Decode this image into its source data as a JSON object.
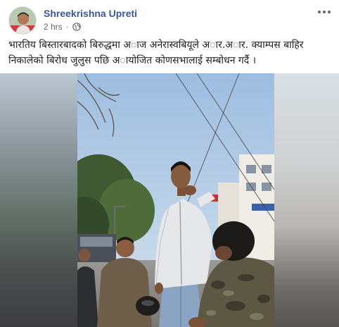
{
  "post": {
    "author_name": "Shreekrishna Upreti",
    "timestamp": "2 hrs",
    "separator": "·",
    "privacy_icon": "globe-icon",
    "menu_icon": "more-options-icon",
    "caption": "भारतिय बिस्तारबादको बिरुद्धमा अाज अनेरास्वबियूले अार.अार. क्याम्पस बाहिर निकालेको बिरोध जुलुस पछि अायोजित कोणसभालाई सम्बोधन गर्दै ।"
  },
  "media": {
    "type": "video",
    "colors": {
      "sky": "#a9c6e4",
      "jacket": "#e4e6e8",
      "jeans": "#8aa2c2",
      "camo": "#5e5a46"
    }
  },
  "colors": {
    "link": "#385898",
    "meta": "#616770",
    "text": "#1c1e21"
  }
}
